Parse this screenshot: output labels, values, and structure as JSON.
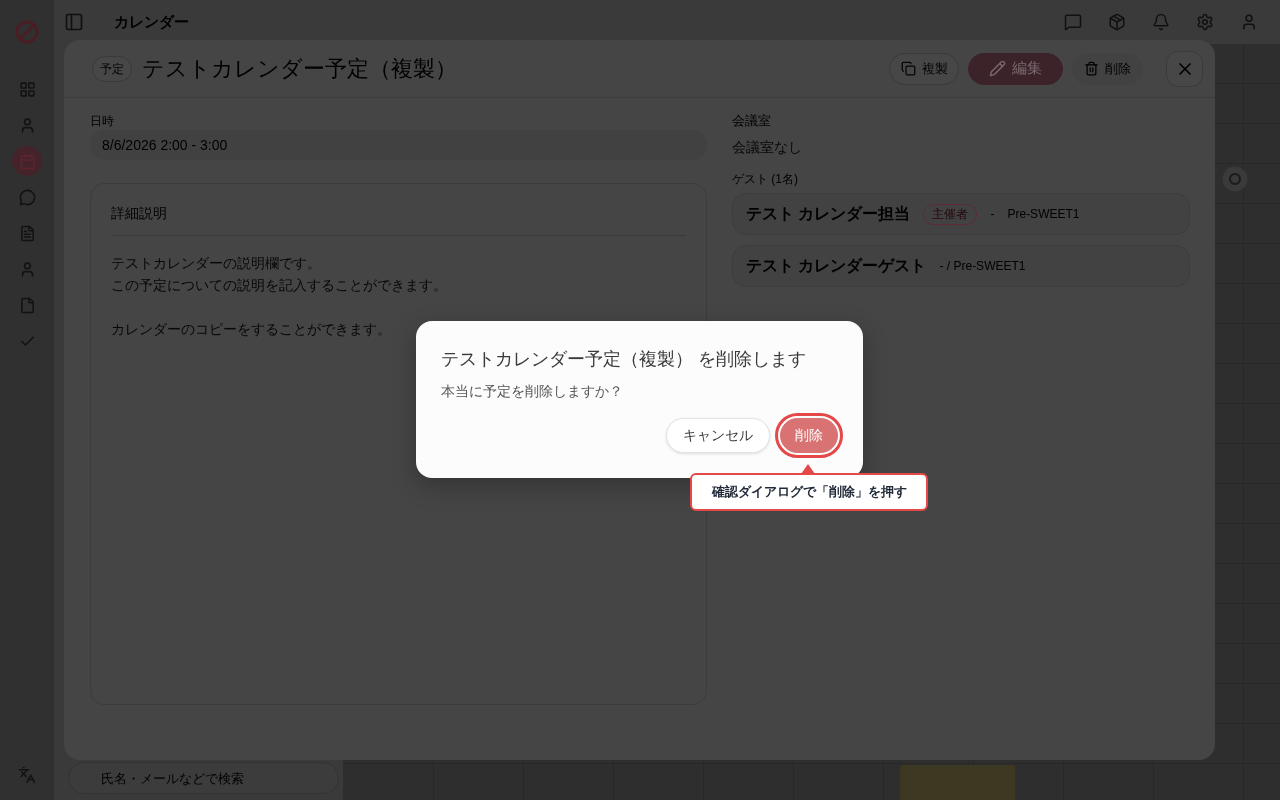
{
  "app": {
    "title": "カレンダー",
    "search": {
      "placeholder": "氏名・メールなどで検索"
    }
  },
  "sidebar": {
    "items": [
      {
        "selected": false
      },
      {
        "selected": false
      },
      {
        "selected": true
      },
      {
        "selected": false
      },
      {
        "selected": false
      },
      {
        "selected": false
      },
      {
        "selected": false
      },
      {
        "selected": false
      }
    ]
  },
  "event_modal": {
    "tag": "予定",
    "title": "テストカレンダー予定（複製）",
    "actions": [
      {
        "label": "複製",
        "kind": "outline"
      },
      {
        "label": "編集",
        "kind": "primary"
      },
      {
        "label": "削除",
        "kind": "subtle"
      }
    ],
    "datetime": {
      "label": "日時",
      "value": "8/6/2026 2:00 - 3:00"
    },
    "description": {
      "heading": "詳細説明",
      "paragraphs": [
        [
          "テストカレンダーの説明欄です。",
          "この予定についての説明を記入することができます。"
        ],
        [
          "カレンダーのコピーをすることができます。"
        ]
      ]
    },
    "room": {
      "label": "会議室",
      "value": "会議室なし"
    },
    "guests": {
      "label": "ゲスト (1名)",
      "items": [
        {
          "name": "テスト カレンダー担当",
          "role": "主催者",
          "details": [
            "-",
            "Pre-SWEET1"
          ]
        },
        {
          "name": "テスト カレンダーゲスト",
          "details": [
            "- / Pre-SWEET1"
          ]
        }
      ]
    }
  },
  "confirm_dialog": {
    "title": "テストカレンダー予定（複製） を削除します",
    "message": "本当に予定を削除しますか？",
    "buttons": [
      {
        "label": "キャンセル",
        "kind": "secondary",
        "highlighted": false
      },
      {
        "label": "削除",
        "kind": "danger",
        "highlighted": true
      }
    ]
  },
  "guide_callout": {
    "text": "確認ダイアログで「削除」を押す"
  }
}
